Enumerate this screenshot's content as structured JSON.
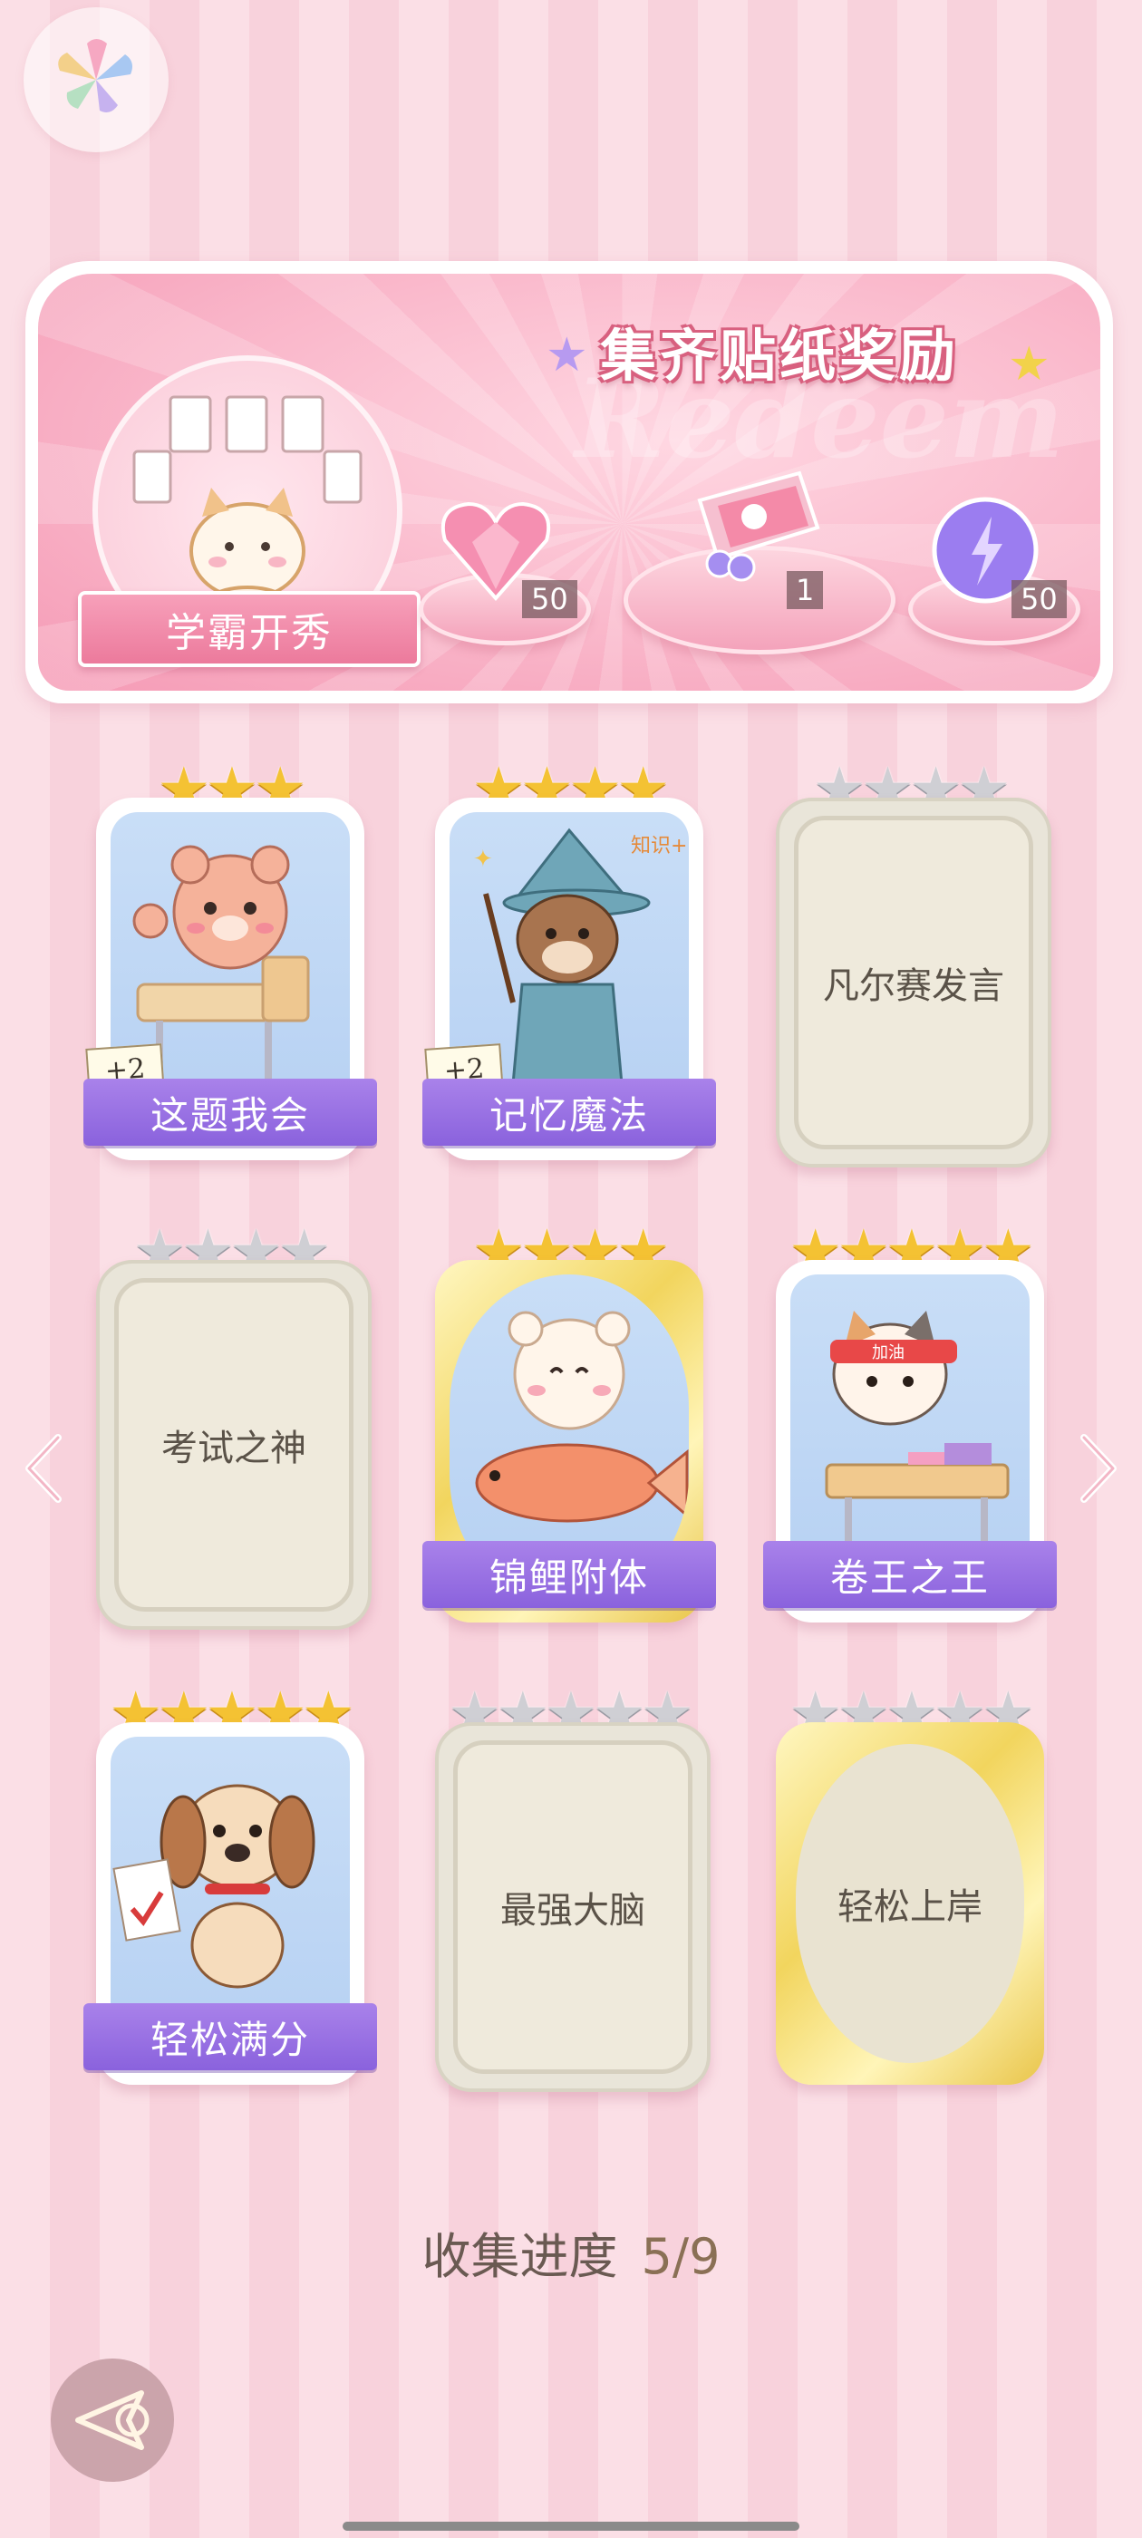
{
  "banner": {
    "title": "集齐贴纸奖励",
    "watermark": "Redeem",
    "ribbon_label": "学霸开秀",
    "rewards": [
      {
        "icon": "heart-gem-icon",
        "count": "50"
      },
      {
        "icon": "gift-box-icon",
        "count": "1"
      },
      {
        "icon": "energy-orb-icon",
        "count": "50"
      }
    ]
  },
  "cards": [
    {
      "name": "这题我会",
      "unlocked": true,
      "stars": 3,
      "max_stars": 3,
      "bonus": "+2",
      "art": "bear-at-desk"
    },
    {
      "name": "记忆魔法",
      "unlocked": true,
      "stars": 4,
      "max_stars": 4,
      "bonus": "+2",
      "art": "otter-wizard"
    },
    {
      "name": "凡尔赛发言",
      "unlocked": false,
      "stars": 0,
      "max_stars": 4
    },
    {
      "name": "考试之神",
      "unlocked": false,
      "stars": 0,
      "max_stars": 4
    },
    {
      "name": "锦鲤附体",
      "unlocked": true,
      "stars": 4,
      "max_stars": 4,
      "art": "bear-with-koi",
      "gold": true
    },
    {
      "name": "卷王之王",
      "unlocked": true,
      "stars": 5,
      "max_stars": 5,
      "art": "cat-studying"
    },
    {
      "name": "轻松满分",
      "unlocked": true,
      "stars": 5,
      "max_stars": 5,
      "art": "puppy-full-marks"
    },
    {
      "name": "最强大脑",
      "unlocked": false,
      "stars": 0,
      "max_stars": 5
    },
    {
      "name": "轻松上岸",
      "unlocked": false,
      "stars": 0,
      "max_stars": 5,
      "gold": true
    }
  ],
  "progress": {
    "label": "收集进度",
    "value": "5/9"
  },
  "colors": {
    "accent_purple": "#8a62dd",
    "pink": "#f59ab5",
    "gold": "#f4c233"
  }
}
